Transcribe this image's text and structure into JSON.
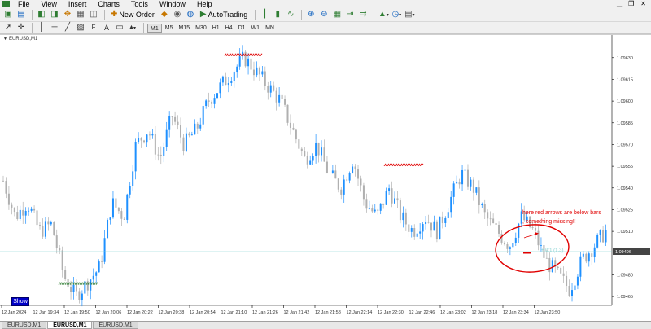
{
  "menu": [
    "File",
    "View",
    "Insert",
    "Charts",
    "Tools",
    "Window",
    "Help"
  ],
  "toolbar": {
    "new_order": "New Order",
    "auto_trading": "AutoTrading"
  },
  "timeframes": [
    {
      "label": "M1",
      "active": true
    },
    {
      "label": "M5",
      "active": false
    },
    {
      "label": "M15",
      "active": false
    },
    {
      "label": "M30",
      "active": false
    },
    {
      "label": "H1",
      "active": false
    },
    {
      "label": "H4",
      "active": false
    },
    {
      "label": "D1",
      "active": false
    },
    {
      "label": "W1",
      "active": false
    },
    {
      "label": "MN",
      "active": false
    }
  ],
  "chart": {
    "title": "EURUSD,M1",
    "current_price": "1.09496",
    "show_button": "Show",
    "annotation_text": "here red arrows are below bars , something missing!!",
    "trade_label": "+ 0:1 (1.3)"
  },
  "chart_data": {
    "type": "candlestick",
    "symbol": "EURUSD",
    "timeframe": "M1",
    "ylim": [
      1.0946,
      1.0964
    ],
    "y_ticks": [
      "1.09630",
      "1.09615",
      "1.09600",
      "1.09585",
      "1.09570",
      "1.09555",
      "1.09540",
      "1.09525",
      "1.09510",
      "1.09496",
      "1.09480",
      "1.09465"
    ],
    "x_ticks": [
      "12 Jan 2024",
      "12 Jan 19:34",
      "12 Jan 19:50",
      "12 Jan 20:06",
      "12 Jan 20:22",
      "12 Jan 20:38",
      "12 Jan 20:54",
      "12 Jan 21:10",
      "12 Jan 21:26",
      "12 Jan 21:42",
      "12 Jan 21:58",
      "12 Jan 22:14",
      "12 Jan 22:30",
      "12 Jan 22:46",
      "12 Jan 23:02",
      "12 Jan 23:18",
      "12 Jan 23:34",
      "12 Jan 23:50"
    ],
    "price_path": [
      1.09545,
      1.0952,
      1.0953,
      1.0951,
      1.09515,
      1.0948,
      1.09465,
      1.09475,
      1.09485,
      1.0953,
      1.0952,
      1.0957,
      1.0958,
      1.0956,
      1.0959,
      1.0957,
      1.0958,
      1.096,
      1.0961,
      1.0962,
      1.0963,
      1.0962,
      1.0961,
      1.096,
      1.0958,
      1.0956,
      1.0957,
      1.0955,
      1.0954,
      1.0956,
      1.0953,
      1.0952,
      1.0954,
      1.0952,
      1.0951,
      1.0952,
      1.0951,
      1.0953,
      1.0955,
      1.0954,
      1.0952,
      1.0951,
      1.095,
      1.0952,
      1.0951,
      1.0949,
      1.0948,
      1.0947,
      1.0949,
      1.095,
      1.0951
    ],
    "marks": [
      {
        "type": "high",
        "price": 1.09632
      },
      {
        "type": "high",
        "price": 1.09556
      },
      {
        "type": "low",
        "price": 1.09474
      }
    ],
    "colors": {
      "up": "#1e90ff",
      "down": "#b0b0b0",
      "marker_red": "#e00000",
      "marker_green": "#2e7d32",
      "annotation": "#e00000",
      "price_line": "#7fcfcf"
    }
  },
  "tabs": [
    {
      "label": "EURUSD,M1",
      "active": false
    },
    {
      "label": "EURUSD,M1",
      "active": true
    },
    {
      "label": "EURUSD,M1",
      "active": false
    }
  ]
}
